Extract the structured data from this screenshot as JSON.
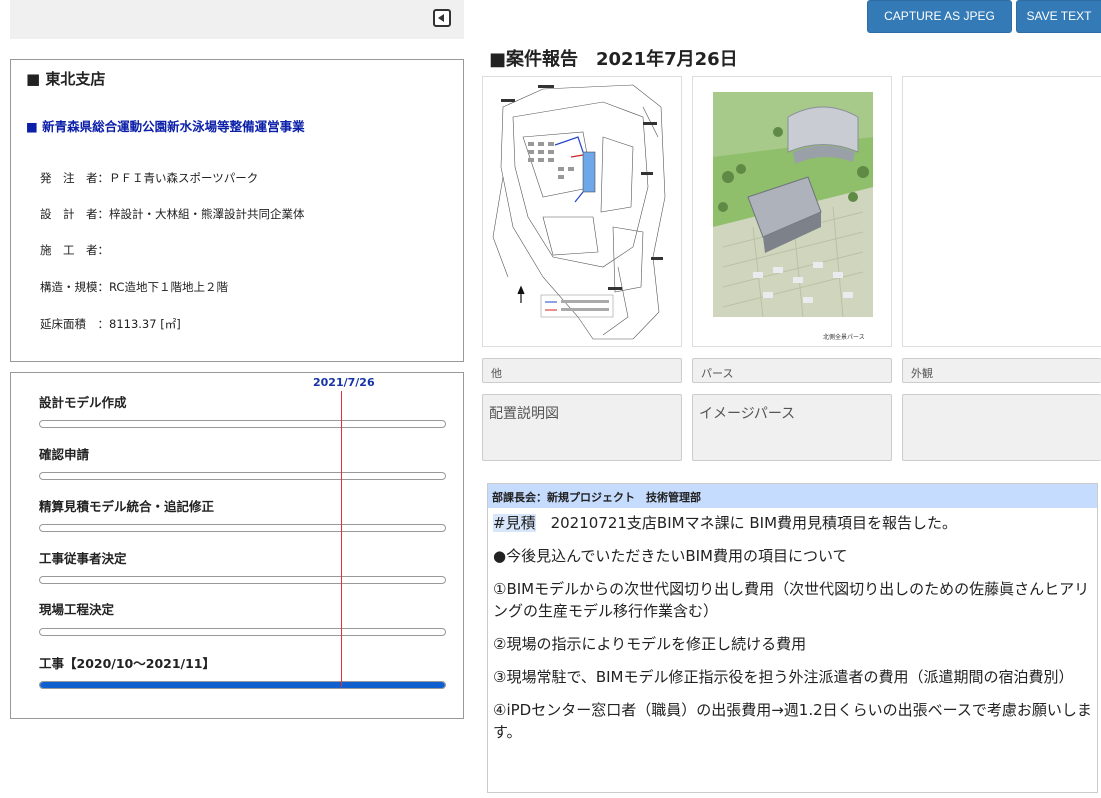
{
  "toolbar": {
    "capture_label": "CAPTURE AS JPEG",
    "save_text_label": "SAVE TEXT"
  },
  "branch": {
    "title": "■ 東北支店",
    "project_name": "■ 新青森県総合運動公園新水泳場等整備運営事業",
    "rows": [
      {
        "label": "発　注　者：",
        "value": "ＰＦＩ青い森スポーツパーク"
      },
      {
        "label": "設　計　者：",
        "value": "梓設計・大林組・熊澤設計共同企業体"
      },
      {
        "label": "施　工　者：",
        "value": ""
      },
      {
        "label": "構造・規模：",
        "value": "RC造地下１階地上２階"
      },
      {
        "label": "延床面積　：",
        "value": "8113.37 [㎡]"
      }
    ]
  },
  "schedule": {
    "today_label": "2021/7/26",
    "tasks": [
      {
        "label": "設計モデル作成",
        "progress": 0
      },
      {
        "label": "確認申請",
        "progress": 0
      },
      {
        "label": "精算見積モデル統合・追記修正",
        "progress": 0
      },
      {
        "label": "工事従事者決定",
        "progress": 0
      },
      {
        "label": "現場工程決定",
        "progress": 0
      },
      {
        "label": "工事【2020/10～2021/11】",
        "progress": 1.0
      }
    ]
  },
  "report": {
    "title": "■案件報告　2021年7月26日",
    "images": [
      {
        "caption": "他",
        "description": "配置説明図"
      },
      {
        "caption": "パース",
        "description": "イメージパース",
        "inner_label": "北側全景パース"
      },
      {
        "caption": "外観",
        "description": ""
      }
    ]
  },
  "meeting": {
    "header": "部課長会：新規プロジェクト　技術管理部",
    "hashtag": "#見積",
    "line1_rest": "　20210721支店BIMマネ課に BIM費用見積項目を報告した。",
    "line2": "●今後見込んでいただきたいBIM費用の項目について",
    "line3": "①BIMモデルからの次世代図切り出し費用（次世代図切り出しのための佐藤眞さんヒアリングの生産モデル移行作業含む）",
    "line4": "②現場の指示によりモデルを修正し続ける費用",
    "line5": "③現場常駐で、BIMモデル修正指示役を担う外注派遣者の費用（派遣期間の宿泊費別）",
    "line6": "④iPDセンター窓口者（職員）の出張費用→週1.2日くらいの出張ベースで考慮お願いします。"
  },
  "colors": {
    "accent_blue": "#337ab7",
    "progress_blue": "#0f5fce",
    "today_line": "#e03040",
    "project_name": "#0b1fa8",
    "meeting_header_bg": "#c6dcff"
  }
}
